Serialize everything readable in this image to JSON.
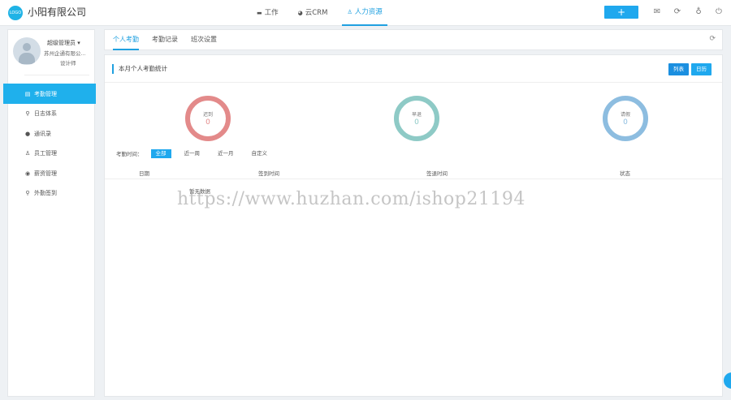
{
  "header": {
    "logo_text": "LOGO",
    "company": "小阳有限公司",
    "nav": [
      {
        "label": "工作",
        "icon": "briefcase-icon"
      },
      {
        "label": "云CRM",
        "icon": "pie-icon"
      },
      {
        "label": "人力资源",
        "icon": "people-icon",
        "active": true
      }
    ],
    "add_label": "+"
  },
  "profile": {
    "name": "超级管理员",
    "company": "苏州企通有限公...",
    "title": "设计师"
  },
  "sidebar": {
    "items": [
      {
        "label": "考勤管理",
        "icon": "clipboard-icon",
        "active": true
      },
      {
        "label": "日志体系",
        "icon": "location-icon"
      },
      {
        "label": "通讯录",
        "icon": "contact-icon"
      },
      {
        "label": "员工管理",
        "icon": "staff-icon"
      },
      {
        "label": "薪资管理",
        "icon": "money-icon"
      },
      {
        "label": "外勤签到",
        "icon": "location-icon"
      }
    ]
  },
  "tabs": [
    {
      "label": "个人考勤",
      "active": true
    },
    {
      "label": "考勤记录"
    },
    {
      "label": "班次设置"
    }
  ],
  "panel": {
    "title": "本月个人考勤统计",
    "view_list": "列表",
    "view_calendar": "日历",
    "stats": [
      {
        "label": "迟到",
        "value": "0",
        "color": "#e38a8a"
      },
      {
        "label": "早退",
        "value": "0",
        "color": "#8ecac6"
      },
      {
        "label": "请假",
        "value": "0",
        "color": "#8dbde0"
      }
    ],
    "filter_label": "考勤时间：",
    "filter_options": [
      {
        "label": "全部",
        "active": true
      },
      {
        "label": "近一周"
      },
      {
        "label": "近一月"
      },
      {
        "label": "自定义"
      }
    ],
    "columns": [
      "日期",
      "签到时间",
      "签退时间",
      "状态"
    ],
    "empty_text": "暂无数据"
  },
  "watermark": "https://www.huzhan.com/ishop21194"
}
